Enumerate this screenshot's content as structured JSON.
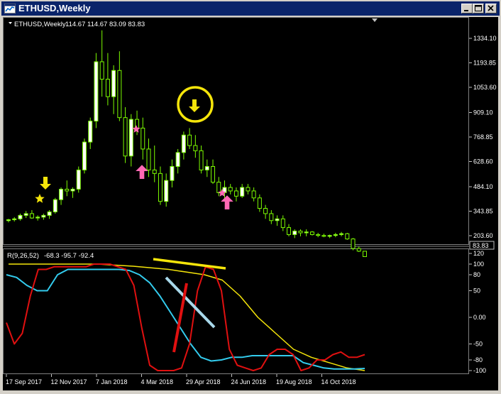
{
  "window": {
    "title": "ETHUSD,Weekly",
    "controls": {
      "minimize": "minimize-icon",
      "maximize": "maximize-icon",
      "close": "close-icon"
    }
  },
  "colors": {
    "background": "#000000",
    "candle": "#7cfc00",
    "bull_body": "#ffffff",
    "axis": "#c0c0c0",
    "rsi_fast": "#e01010",
    "rsi_mid": "#33ccee",
    "rsi_slow": "#f5e50a",
    "arrow_down": "#f5e50a",
    "arrow_up": "#ff69b4",
    "star_yellow": "#f5e50a",
    "star_pink": "#ff69b4",
    "trend_yellow": "#f5e50a",
    "trend_light": "#a8d8ea",
    "trend_red": "#e01010"
  },
  "price_panel": {
    "header": {
      "symbol": "ETHUSD,Weekly",
      "ohlc": "114.67 114.67 83.09 83.83"
    },
    "y_ticks": [
      "1334.10",
      "1193.85",
      "1053.60",
      "909.10",
      "768.85",
      "628.60",
      "484.10",
      "343.85",
      "203.60"
    ],
    "last_price": "83.83"
  },
  "rsi_panel": {
    "header": {
      "label": "R(9,26,52)",
      "values": "-68.3 -95.7 -92.4"
    },
    "y_ticks": [
      "120",
      "100",
      "80",
      "50",
      "0.00",
      "-50",
      "-80",
      "-100"
    ]
  },
  "x_ticks": [
    "17 Sep 2017",
    "12 Nov 2017",
    "7 Jan 2018",
    "4 Mar 2018",
    "29 Apr 2018",
    "24 Jun 2018",
    "19 Aug 2018",
    "14 Oct 2018"
  ],
  "chart_data": {
    "type": "candlestick",
    "series": [
      {
        "name": "ETHUSD,Weekly",
        "ohlc": [
          [
            290,
            300,
            280,
            295
          ],
          [
            295,
            310,
            285,
            300
          ],
          [
            300,
            330,
            290,
            320
          ],
          [
            320,
            345,
            305,
            330
          ],
          [
            330,
            350,
            300,
            305
          ],
          [
            305,
            320,
            290,
            310
          ],
          [
            310,
            330,
            295,
            320
          ],
          [
            320,
            350,
            300,
            340
          ],
          [
            340,
            420,
            330,
            410
          ],
          [
            410,
            480,
            380,
            470
          ],
          [
            470,
            520,
            430,
            460
          ],
          [
            460,
            480,
            420,
            470
          ],
          [
            470,
            600,
            450,
            580
          ],
          [
            580,
            760,
            560,
            740
          ],
          [
            740,
            880,
            700,
            860
          ],
          [
            860,
            1250,
            820,
            1200
          ],
          [
            1200,
            1380,
            1000,
            1100
          ],
          [
            1100,
            1250,
            950,
            1000
          ],
          [
            1000,
            1180,
            900,
            1150
          ],
          [
            1150,
            1260,
            860,
            880
          ],
          [
            880,
            940,
            620,
            660
          ],
          [
            660,
            900,
            600,
            870
          ],
          [
            870,
            920,
            780,
            820
          ],
          [
            820,
            880,
            640,
            700
          ],
          [
            700,
            760,
            540,
            580
          ],
          [
            580,
            720,
            510,
            560
          ],
          [
            560,
            600,
            380,
            400
          ],
          [
            400,
            560,
            370,
            520
          ],
          [
            520,
            640,
            480,
            600
          ],
          [
            600,
            700,
            560,
            680
          ],
          [
            680,
            800,
            640,
            780
          ],
          [
            780,
            820,
            700,
            720
          ],
          [
            720,
            780,
            650,
            690
          ],
          [
            690,
            720,
            560,
            580
          ],
          [
            580,
            640,
            540,
            600
          ],
          [
            600,
            640,
            500,
            510
          ],
          [
            510,
            540,
            430,
            450
          ],
          [
            450,
            520,
            410,
            480
          ],
          [
            480,
            500,
            440,
            460
          ],
          [
            460,
            480,
            400,
            430
          ],
          [
            430,
            500,
            420,
            480
          ],
          [
            480,
            500,
            440,
            460
          ],
          [
            460,
            480,
            400,
            420
          ],
          [
            420,
            440,
            340,
            360
          ],
          [
            360,
            380,
            300,
            330
          ],
          [
            330,
            350,
            270,
            290
          ],
          [
            290,
            320,
            260,
            300
          ],
          [
            300,
            320,
            230,
            250
          ],
          [
            250,
            270,
            200,
            210
          ],
          [
            210,
            240,
            190,
            230
          ],
          [
            230,
            240,
            200,
            220
          ],
          [
            220,
            240,
            200,
            225
          ],
          [
            225,
            230,
            205,
            210
          ],
          [
            210,
            220,
            195,
            205
          ],
          [
            205,
            215,
            195,
            200
          ],
          [
            200,
            210,
            190,
            205
          ],
          [
            205,
            220,
            195,
            210
          ],
          [
            210,
            225,
            200,
            215
          ],
          [
            215,
            220,
            180,
            185
          ],
          [
            185,
            190,
            120,
            130
          ],
          [
            130,
            140,
            110,
            115
          ],
          [
            114.67,
            114.67,
            83.09,
            83.83
          ]
        ]
      },
      {
        "name": "RSI fast",
        "values": [
          -10,
          -50,
          -30,
          40,
          90,
          90,
          95,
          95,
          95,
          95,
          95,
          100,
          100,
          100,
          95,
          90,
          60,
          -20,
          -90,
          -100,
          -100,
          -100,
          -95,
          -50,
          50,
          95,
          90,
          50,
          -60,
          -90,
          -95,
          -100,
          -95,
          -70,
          -60,
          -60,
          -70,
          -100,
          -95,
          -80,
          -80,
          -70,
          -65,
          -75,
          -75,
          -70
        ]
      },
      {
        "name": "RSI mid",
        "values": [
          80,
          75,
          60,
          50,
          50,
          80,
          90,
          90,
          90,
          90,
          90,
          90,
          88,
          80,
          65,
          40,
          10,
          -20,
          -50,
          -75,
          -82,
          -80,
          -75,
          -75,
          -72,
          -72,
          -72,
          -72,
          -72,
          -85,
          -90,
          -95,
          -97,
          -97,
          -97,
          -96
        ]
      },
      {
        "name": "RSI slow",
        "values": [
          100,
          100,
          100,
          100,
          100,
          100,
          98,
          96,
          93,
          90,
          85,
          80,
          70,
          40,
          0,
          -30,
          -60,
          -75,
          -85,
          -95,
          -100
        ]
      }
    ],
    "markers": [
      {
        "type": "arrow-down",
        "color": "#f5e50a",
        "bar": 10
      },
      {
        "type": "star",
        "color": "#f5e50a",
        "bar": 9
      },
      {
        "type": "arrow-down",
        "color": "#f5e50a",
        "bar": 53
      },
      {
        "type": "star",
        "color": "#ff69b4",
        "bar": 37
      },
      {
        "type": "arrow-up",
        "color": "#ff69b4",
        "bar": 39
      },
      {
        "type": "star",
        "color": "#ff69b4",
        "bar": 61
      },
      {
        "type": "arrow-up",
        "color": "#ff69b4",
        "bar": 63
      }
    ],
    "ylim": [
      100,
      1400
    ],
    "rsi_ylim": [
      -110,
      125
    ]
  }
}
